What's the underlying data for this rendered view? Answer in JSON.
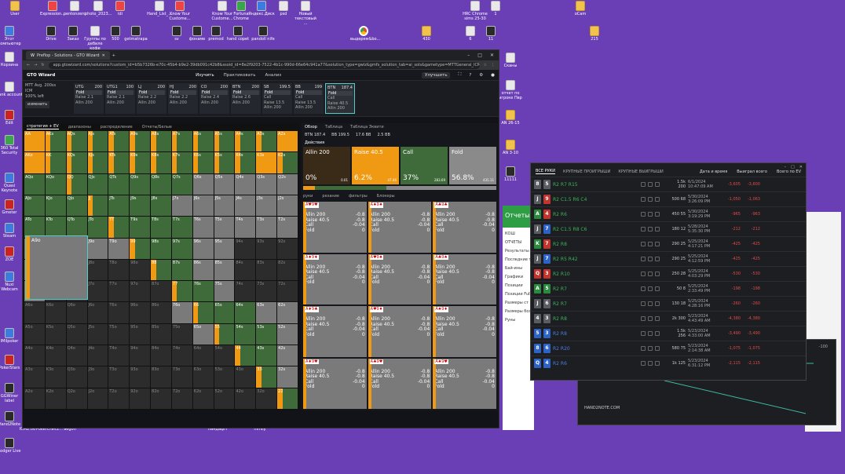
{
  "desktop": {
    "icons_top": [
      {
        "label": "User",
        "type": "folder"
      },
      {
        "label": "Expression...",
        "type": "pdf"
      },
      {
        "label": "pentonzero",
        "type": "doc"
      },
      {
        "label": "photo_2023...",
        "type": "doc"
      },
      {
        "label": "idi",
        "type": "pdf"
      },
      {
        "label": "Hand_List_...",
        "type": "doc"
      },
      {
        "label": "Know Your Custome...",
        "type": "pdf"
      },
      {
        "label": "Know Your Custome...",
        "type": "doc"
      },
      {
        "label": "Fortuna Chrome",
        "type": "green"
      },
      {
        "label": "Яндекс.Диск",
        "type": "blue"
      },
      {
        "label": "psd",
        "type": "doc"
      },
      {
        "label": "Новый текстовый ...",
        "type": "doc"
      },
      {
        "label": "HRC Chrome sims 25-30",
        "type": "doc"
      },
      {
        "label": "1",
        "type": "doc"
      },
      {
        "label": "oCam",
        "type": "folder"
      }
    ],
    "icons_row2": [
      {
        "label": "Drive",
        "type": "dark"
      },
      {
        "label": "Заказ",
        "type": "dark"
      },
      {
        "label": "Группы по дебиле кофе",
        "type": "doc"
      },
      {
        "label": "500",
        "type": "dark"
      },
      {
        "label": "getmatrapa",
        "type": "dark"
      },
      {
        "label": "sv",
        "type": "dark"
      },
      {
        "label": "фонаме",
        "type": "dark"
      },
      {
        "label": "premod",
        "type": "dark"
      },
      {
        "label": "hand copet",
        "type": "dark"
      },
      {
        "label": "pandoll nife",
        "type": "dark"
      },
      {
        "label": "выдерем&bo...",
        "type": "chrome"
      },
      {
        "label": "430",
        "type": "folder"
      },
      {
        "label": "6",
        "type": "doc"
      },
      {
        "label": "11",
        "type": "dark"
      },
      {
        "label": "215",
        "type": "folder"
      }
    ],
    "icons_left": [
      {
        "label": "Этот компьютер",
        "type": "blue"
      },
      {
        "label": "Корзина",
        "type": "doc"
      },
      {
        "label": "bank account",
        "type": "doc"
      },
      {
        "label": "Edit",
        "type": "red"
      },
      {
        "label": "360 Total Security",
        "type": "green"
      },
      {
        "label": "Quasi Keynote",
        "type": "blue"
      },
      {
        "label": "Gmeter",
        "type": "red"
      },
      {
        "label": "Steam",
        "type": "blue"
      },
      {
        "label": "ZOE",
        "type": "red"
      },
      {
        "label": "Nuxi Webcam",
        "type": "blue"
      },
      {
        "label": "IMilpoker",
        "type": "blue"
      },
      {
        "label": "PokerStars",
        "type": "red"
      },
      {
        "label": "GGWiner label",
        "type": "dark"
      },
      {
        "label": "Hand2Note",
        "type": "dark"
      },
      {
        "label": "Lodger Live",
        "type": "dark"
      }
    ],
    "icons_right": [
      {
        "label": "Сканы",
        "type": "doc"
      },
      {
        "label": "отчет по игроке Пвр",
        "type": "doc"
      },
      {
        "label": "AN 26-15",
        "type": "folder"
      },
      {
        "label": "AN 3-10",
        "type": "folder"
      },
      {
        "label": "11111",
        "type": "dark"
      }
    ],
    "icons_bottom": [
      {
        "label": "ICM2.06",
        "type": "red"
      },
      {
        "label": "PokerCraft2...",
        "type": "red"
      },
      {
        "label": "aegon",
        "type": "blue"
      },
      {
        "label": "пандафП",
        "type": "folder"
      },
      {
        "label": "nimily",
        "type": "folder"
      }
    ]
  },
  "browser": {
    "tab_title": "Preflop - Solutions - GTO Wizard",
    "url": "app.gtowizard.com/solutions?custom_id=b5b7326b-e70c-45b4-b9e2-39db091c42b8&ssoid_id=8e2f9203-7522-4b1c-990d-66e64c941a77&solution_type=gwiz&gmfs_solution_tab=ai_sols&gametype=MTTGeneral_ICMfinal...",
    "win_controls": [
      "–",
      "□",
      "✕"
    ]
  },
  "app": {
    "logo": "GTO Wizard",
    "nav": [
      "Изучить",
      "Практиковать",
      "Анализ"
    ],
    "upgrade": "Улучшить",
    "seat_info": [
      "MTT Avg. 200ss",
      "ICM",
      "100% left"
    ],
    "change_btn": "изменить",
    "seats": [
      {
        "pos": "UTG",
        "stack": "200",
        "actions": [
          "Fold",
          "Raise 2.1",
          "Allin 200"
        ]
      },
      {
        "pos": "UTG1",
        "stack": "100",
        "actions": [
          "Fold",
          "Raise 2.1",
          "Allin 200"
        ]
      },
      {
        "pos": "LJ",
        "stack": "200",
        "actions": [
          "Fold",
          "Raise 2.2",
          "Allin 200"
        ]
      },
      {
        "pos": "HJ",
        "stack": "200",
        "actions": [
          "Fold",
          "Raise 2.2",
          "Allin 200"
        ]
      },
      {
        "pos": "CO",
        "stack": "200",
        "actions": [
          "Fold",
          "Raise 2.4",
          "Allin 200"
        ]
      },
      {
        "pos": "BTN",
        "stack": "200",
        "actions": [
          "Fold",
          "Raise 2.6",
          "Allin 200"
        ]
      },
      {
        "pos": "SB",
        "stack": "199.5",
        "actions": [
          "Fold",
          "Call",
          "Raise 13.5",
          "Allin 200"
        ]
      },
      {
        "pos": "BB",
        "stack": "199",
        "actions": [
          "Fold",
          "Call",
          "Raise 13.5",
          "Allin 200"
        ]
      },
      {
        "pos": "BTN",
        "stack": "187.4",
        "actions": [
          "Fold",
          "Call",
          "Raise 40.5",
          "Allin 200"
        ]
      }
    ],
    "grid_tabs": [
      "стратегия + EV",
      "диапазоны",
      "распределение",
      "Отчеты/Белые"
    ],
    "matrix": [
      [
        "AA",
        "AKs",
        "AQs",
        "AJs",
        "ATs",
        "A9s",
        "A8s",
        "A7s",
        "A6s",
        "A5s",
        "A4s",
        "A3s",
        "A2s"
      ],
      [
        "AKo",
        "KK",
        "KQs",
        "KJs",
        "KTs",
        "K9s",
        "K8s",
        "K7s",
        "K6s",
        "K5s",
        "K4s",
        "K3s",
        "K2s"
      ],
      [
        "AQo",
        "KQo",
        "QQ",
        "QJs",
        "QTs",
        "Q9s",
        "Q8s",
        "Q7s",
        "Q6s",
        "Q5s",
        "Q4s",
        "Q3s",
        "Q2s"
      ],
      [
        "AJo",
        "KJo",
        "QJo",
        "JJ",
        "JTs",
        "J9s",
        "J8s",
        "J7s",
        "J6s",
        "J5s",
        "J4s",
        "J3s",
        "J2s"
      ],
      [
        "ATo",
        "KTo",
        "QTo",
        "JTo",
        "TT",
        "T9s",
        "T8s",
        "T7s",
        "T6s",
        "T5s",
        "T4s",
        "T3s",
        "T2s"
      ],
      [
        "A9o",
        "K9o",
        "Q9o",
        "J9o",
        "T9o",
        "99",
        "98s",
        "97s",
        "96s",
        "95s",
        "94s",
        "93s",
        "92s"
      ],
      [
        "A8o",
        "K8o",
        "Q8o",
        "J8o",
        "T8o",
        "98o",
        "88",
        "87s",
        "86s",
        "85s",
        "84s",
        "83s",
        "82s"
      ],
      [
        "A7o",
        "K7o",
        "Q7o",
        "J7o",
        "T7o",
        "97o",
        "87o",
        "77",
        "76s",
        "75s",
        "74s",
        "73s",
        "72s"
      ],
      [
        "A6o",
        "K6o",
        "Q6o",
        "J6o",
        "T6o",
        "96o",
        "86o",
        "76o",
        "66",
        "65s",
        "64s",
        "63s",
        "62s"
      ],
      [
        "A5o",
        "K5o",
        "Q5o",
        "J5o",
        "T5o",
        "95o",
        "85o",
        "75o",
        "65o",
        "55",
        "54s",
        "53s",
        "52s"
      ],
      [
        "A4o",
        "K4o",
        "Q4o",
        "J4o",
        "T4o",
        "94o",
        "84o",
        "74o",
        "64o",
        "54o",
        "44",
        "43s",
        "42s"
      ],
      [
        "A3o",
        "K3o",
        "Q3o",
        "J3o",
        "T3o",
        "93o",
        "83o",
        "73o",
        "63o",
        "53o",
        "43o",
        "33",
        "32s"
      ],
      [
        "A2o",
        "K2o",
        "Q2o",
        "J2o",
        "T2o",
        "92o",
        "82o",
        "72o",
        "62o",
        "52o",
        "42o",
        "32o",
        "22"
      ]
    ],
    "strategy": {
      "tabs": [
        "Обзор",
        "Таблица",
        "Таблица Эквити"
      ],
      "stats": [
        "BTN 187.4",
        "BB 199.5",
        "17.6 BB",
        "2.5 BB"
      ],
      "actions_label": "Действия",
      "actions": [
        {
          "name": "Allin 200",
          "pct": "0%",
          "ev": "0.01"
        },
        {
          "name": "Raise 40.5",
          "pct": "6.2%",
          "ev": "47.46"
        },
        {
          "name": "Call",
          "pct": "37%",
          "ev": "283.69"
        },
        {
          "name": "Fold",
          "pct": "56.8%",
          "ev": "435.11"
        }
      ],
      "hand_tabs": [
        "руки",
        "резание",
        "фильтры",
        "Блокеры"
      ],
      "combos": [
        {
          "cards": "A♥9♥",
          "lines": [
            "Allin 200",
            "Raise 40.5",
            "Call",
            "Fold"
          ],
          "vals": [
            "-0.8",
            "-0.8",
            "-0.04",
            "0"
          ]
        },
        {
          "cards": "A♠9♠",
          "lines": [
            "Allin 200",
            "Raise 40.5",
            "Call",
            "Fold"
          ],
          "vals": [
            "-0.8",
            "-0.8",
            "-0.04",
            "0"
          ]
        },
        {
          "cards": "A♣9♣",
          "lines": [
            "Allin 200",
            "Raise 40.5",
            "Call",
            "Fold"
          ],
          "vals": [
            "-0.8",
            "-0.8",
            "-0.04",
            "0"
          ]
        },
        {
          "cards": "A♦9♦",
          "lines": [
            "Allin 200",
            "Raise 40.5",
            "Call",
            "Fold"
          ],
          "vals": [
            "-0.8",
            "-0.8",
            "-0.04",
            "0"
          ]
        },
        {
          "cards": "A♥9♠",
          "lines": [
            "Allin 200",
            "Raise 40.5",
            "Call",
            "Fold"
          ],
          "vals": [
            "-0.8",
            "-0.8",
            "-0.04",
            "0"
          ]
        },
        {
          "cards": "A♣9♠",
          "lines": [
            "Allin 200",
            "Raise 40.5",
            "Call",
            "Fold"
          ],
          "vals": [
            "-0.8",
            "-0.8",
            "-0.04",
            "0"
          ]
        },
        {
          "cards": "A♦9♣",
          "lines": [
            "Allin 200",
            "Raise 40.5",
            "Call",
            "Fold"
          ],
          "vals": [
            "-0.8",
            "-0.8",
            "-0.04",
            "0"
          ]
        },
        {
          "cards": "A♥9♦",
          "lines": [
            "Allin 200",
            "Raise 40.5",
            "Call",
            "Fold"
          ],
          "vals": [
            "-0.8",
            "-0.8",
            "-0.04",
            "0"
          ]
        },
        {
          "cards": "A♠9♦",
          "lines": [
            "Allin 200",
            "Raise 40.5",
            "Call",
            "Fold"
          ],
          "vals": [
            "-0.8",
            "-0.8",
            "-0.04",
            "0"
          ]
        },
        {
          "cards": "A♦9♥",
          "lines": [
            "Allin 200",
            "Raise 40.5",
            "Call",
            "Fold"
          ],
          "vals": [
            "-0.8",
            "-0.8",
            "-0.04",
            "0"
          ]
        },
        {
          "cards": "A♣9♥",
          "lines": [
            "Allin 200",
            "Raise 40.5",
            "Call",
            "Fold"
          ],
          "vals": [
            "-0.8",
            "-0.8",
            "-0.04",
            "0"
          ]
        },
        {
          "cards": "A♠9♥",
          "lines": [
            "Allin 200",
            "Raise 40.5",
            "Call",
            "Fold"
          ],
          "vals": [
            "-0.8",
            "-0.8",
            "-0.04",
            "0"
          ]
        }
      ]
    }
  },
  "hand_history": {
    "tabs": [
      "ВСЕ РУКИ",
      "КРУПНЫЕ ПРОИГРЫШИ",
      "КРУПНЫЕ ВЫИГРЫШИ"
    ],
    "cols": [
      "Дата и время",
      "Выиграл всего",
      "Всего по EV"
    ],
    "rows": [
      {
        "c1": "8",
        "c2": "5",
        "s1": "g",
        "s2": "g",
        "action": "R2 R7 R15",
        "stakes": "1.5k 200",
        "date": "6/1/2024 10:47:09 AM",
        "win": "-3,605",
        "ev": "-3,600"
      },
      {
        "c1": "J",
        "c2": "9",
        "s1": "g",
        "s2": "r",
        "action": "R2 C1.5 R6 C4",
        "stakes": "500 68",
        "date": "5/30/2024 3:26:09 PM",
        "win": "-1,050",
        "ev": "-1,063"
      },
      {
        "c1": "A",
        "c2": "4",
        "s1": "gr",
        "s2": "r",
        "action": "R2 R6",
        "stakes": "450 55",
        "date": "5/30/2024 3:19:29 PM",
        "win": "-965",
        "ev": "-963"
      },
      {
        "c1": "J",
        "c2": "7",
        "s1": "g",
        "s2": "b",
        "action": "R2 C1.5 R8 C6",
        "stakes": "180 12",
        "date": "5/28/2024 5:35:30 PM",
        "win": "-212",
        "ev": "-212"
      },
      {
        "c1": "K",
        "c2": "7",
        "s1": "gr",
        "s2": "r",
        "action": "R2 R8",
        "stakes": "290 25",
        "date": "5/25/2024 4:17:21 PM",
        "win": "-425",
        "ev": "-425"
      },
      {
        "c1": "J",
        "c2": "7",
        "s1": "g",
        "s2": "b",
        "action": "R2 R5 R42",
        "stakes": "290 25",
        "date": "5/25/2024 4:12:59 PM",
        "win": "-425",
        "ev": "-425"
      },
      {
        "c1": "Q",
        "c2": "3",
        "s1": "r",
        "s2": "r",
        "action": "R2 R10",
        "stakes": "250 28",
        "date": "5/25/2024 4:03:29 PM",
        "win": "-530",
        "ev": "-530"
      },
      {
        "c1": "A",
        "c2": "5",
        "s1": "gr",
        "s2": "gr",
        "action": "R2 R7",
        "stakes": "50 8",
        "date": "5/25/2024 2:33:49 PM",
        "win": "-198",
        "ev": "-198"
      },
      {
        "c1": "J",
        "c2": "6",
        "s1": "g",
        "s2": "g",
        "action": "R2 R7",
        "stakes": "130 18",
        "date": "5/25/2024 4:28:16 PM",
        "win": "-260",
        "ev": "-260"
      },
      {
        "c1": "4",
        "c2": "3",
        "s1": "g",
        "s2": "g",
        "action": "R2 R8",
        "stakes": "2k 300",
        "date": "5/23/2024 4:43:49 AM",
        "win": "-4,380",
        "ev": "-4,380"
      },
      {
        "c1": "5",
        "c2": "3",
        "s1": "b",
        "s2": "b",
        "action": "R2 R8",
        "stakes": "1.5k 256",
        "date": "5/23/2024 4:33:00 AM",
        "win": "-3,490",
        "ev": "-3,490"
      },
      {
        "c1": "8",
        "c2": "6",
        "s1": "b",
        "s2": "b",
        "action": "R2 R20",
        "stakes": "580 75",
        "date": "5/23/2024 2:14:38 AM",
        "win": "-1,075",
        "ev": "-1,075"
      },
      {
        "c1": "Q",
        "c2": "4",
        "s1": "b",
        "s2": "b",
        "action": "R2 R6",
        "stakes": "1k 125",
        "date": "5/23/2024 6:31:12 PM",
        "win": "-2,115",
        "ev": "-2,115"
      }
    ]
  },
  "side_window": {
    "title": "Отчеты",
    "menu": [
      "КОШ ОТЧЕТЫ",
      "Результаты",
      "Последние т",
      "Бай-ины",
      "Графики",
      "Позиции",
      "Позиции Full",
      "Размеры ст",
      "Размеры бол",
      "Руны"
    ]
  },
  "graph": {
    "brand": "HAND2NOTE.COM",
    "label": "-100"
  }
}
